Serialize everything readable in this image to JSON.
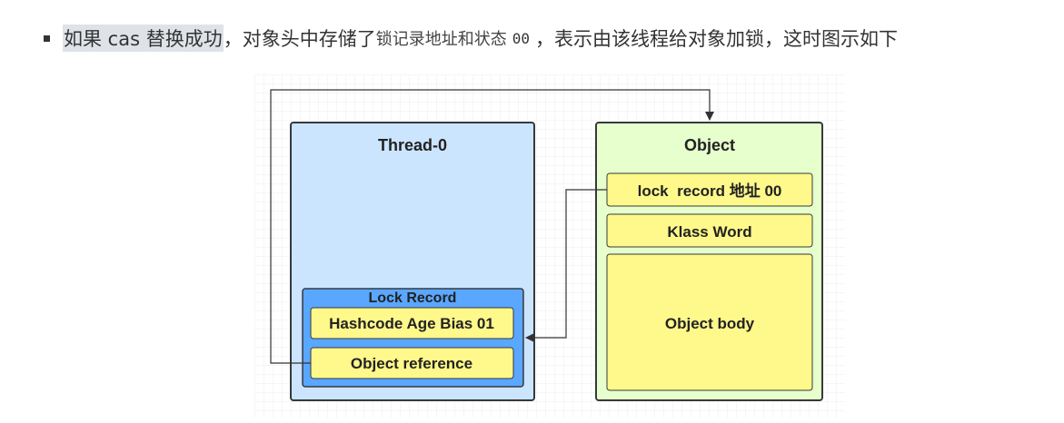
{
  "paragraph": {
    "seg1_highlight": "如果 cas 替换成功",
    "seg2": "，对象头中存储了",
    "seg3_serif": "锁记录地址和状态",
    "seg4_mono": "00",
    "seg5": "，表示由该线程给对象加锁，这时图示如下"
  },
  "diagram": {
    "thread": {
      "title": "Thread-0",
      "lock_record": {
        "title": "Lock Record",
        "fields": [
          "Hashcode Age Bias 01",
          "Object reference"
        ]
      }
    },
    "object": {
      "title": "Object",
      "fields": [
        "lock  record 地址 00",
        "Klass Word",
        "Object body"
      ]
    },
    "colors": {
      "thread_fill": "#cce5ff",
      "lock_record_fill": "#5aa7ff",
      "object_fill": "#e6ffcc",
      "field_fill": "#fff88a",
      "border": "#36393d"
    }
  }
}
